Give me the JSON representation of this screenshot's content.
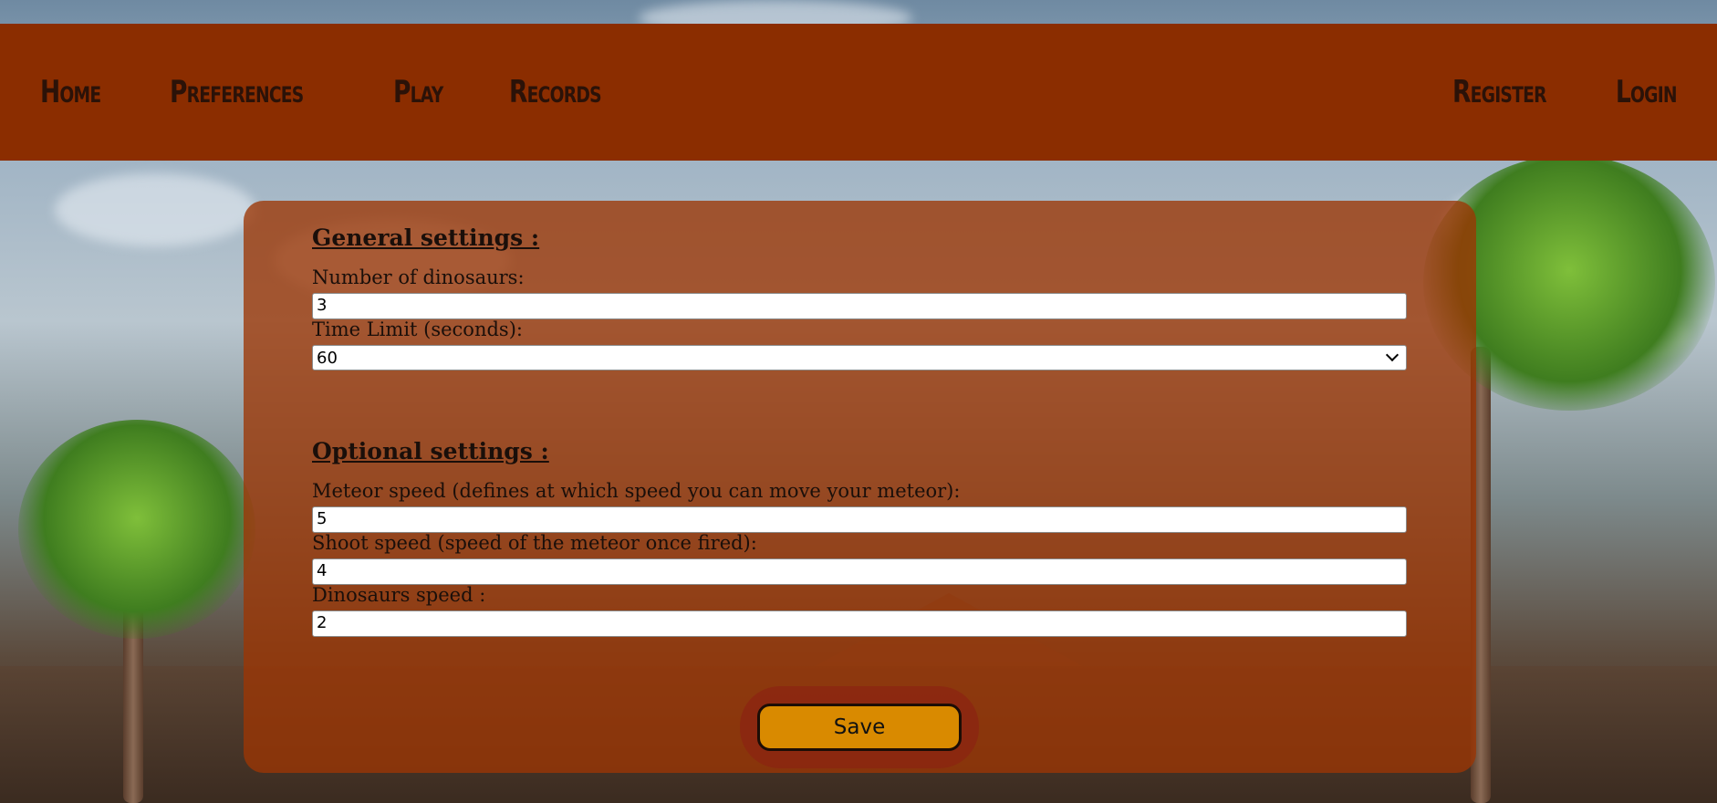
{
  "nav": {
    "left": [
      {
        "label": "Home"
      },
      {
        "label": "Preferences"
      },
      {
        "label": "Play"
      },
      {
        "label": "Records"
      }
    ],
    "right": [
      {
        "label": "Register"
      },
      {
        "label": "Login"
      }
    ]
  },
  "general": {
    "title": "General settings :",
    "dinosaurs_label": "Number of dinosaurs:",
    "dinosaurs_value": "3",
    "time_limit_label": "Time Limit (seconds):",
    "time_limit_value": "60"
  },
  "optional": {
    "title": "Optional settings :",
    "meteor_speed_label": "Meteor speed (defines at which speed you can move your meteor):",
    "meteor_speed_value": "5",
    "shoot_speed_label": "Shoot speed (speed of the meteor once fired):",
    "shoot_speed_value": "4",
    "dino_speed_label": "Dinosaurs speed :",
    "dino_speed_value": "2"
  },
  "save_label": "Save",
  "colors": {
    "navbar": "#8b2d00",
    "panel": "#9c3604",
    "save_button": "#d98a00"
  }
}
